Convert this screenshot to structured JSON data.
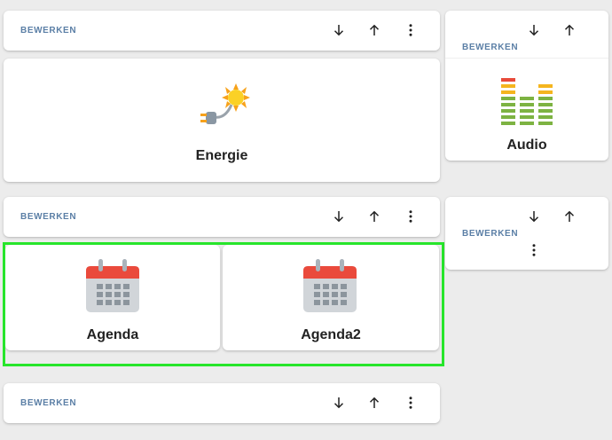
{
  "edit_label": "BEWERKEN",
  "icons": {
    "down": "arrow-down-icon",
    "up": "arrow-up-icon",
    "more": "more-vertical-icon",
    "energy": "sun-plug-icon",
    "audio": "equalizer-icon",
    "calendar": "calendar-icon"
  },
  "tiles": {
    "energie": "Energie",
    "audio": "Audio",
    "agenda": "Agenda",
    "agenda2": "Agenda2"
  },
  "colors": {
    "highlight": "#27e52b",
    "edit_label": "#5b7fa6"
  }
}
